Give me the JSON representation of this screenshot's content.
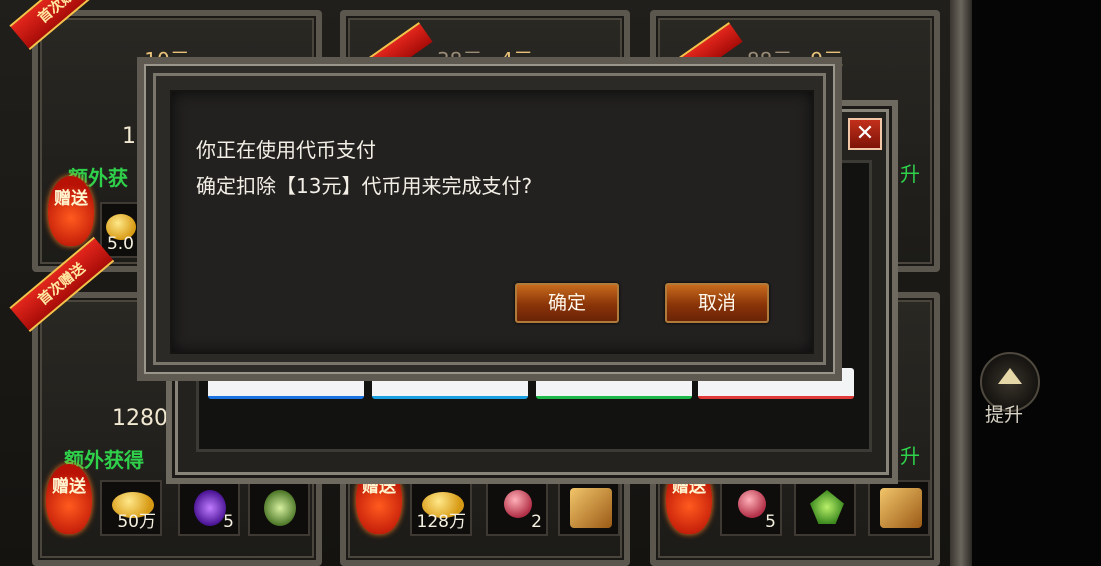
{
  "cards": {
    "c1": {
      "price": "10元",
      "title": "10",
      "extra": "额外获",
      "gift": "赠送",
      "items": [
        {
          "count": "5.0"
        }
      ]
    },
    "c2": {
      "old_price": "38元",
      "price": "4元"
    },
    "c3": {
      "old_price": "88元",
      "price": "9元"
    },
    "c4": {
      "title": "1280",
      "extra": "额外获得",
      "gift": "赠送",
      "items": [
        {
          "count": "50万"
        },
        {
          "count": "5"
        },
        {
          "count": ""
        }
      ]
    },
    "c5": {
      "gift": "赠送",
      "items": [
        {
          "count": "128万"
        },
        {
          "count": "2"
        },
        {
          "count": ""
        }
      ]
    },
    "c6": {
      "gift": "赠送",
      "items": [
        {
          "count": "5"
        },
        {
          "count": ""
        },
        {
          "count": ""
        }
      ]
    }
  },
  "ribbon_text": "首次赠送",
  "back_dialog": {
    "close_label": "✕",
    "side_text_1": "升",
    "side_text_2": "升"
  },
  "dialog": {
    "line1": "你正在使用代币支付",
    "line2": "确定扣除【13元】代币用来完成支付?",
    "confirm": "确定",
    "cancel": "取消"
  },
  "side": {
    "upgrade": "提升"
  },
  "colors": {
    "accent_green": "#2fd14b",
    "gold": "#e8c27a",
    "button": "#a8460c"
  }
}
